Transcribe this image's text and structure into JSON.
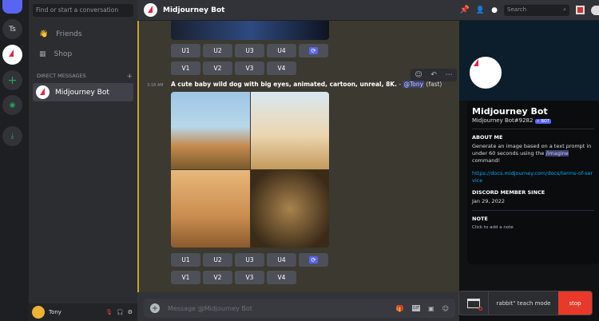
{
  "dm_sidebar": {
    "search_placeholder": "Find or start a conversation",
    "friends": "Friends",
    "shop": "Shop",
    "direct_messages": "DIRECT MESSAGES",
    "add": "+",
    "dm_item": "Midjourney Bot"
  },
  "servers": {
    "ts": "Ts"
  },
  "user": {
    "name": "Tony"
  },
  "header": {
    "title": "Midjourney Bot",
    "search_placeholder": "Search"
  },
  "message": {
    "time": "3:18 AM",
    "prompt": "A cute baby wild dog with big eyes, animated, cartoon, unreal, 8K.",
    "separator": " - ",
    "mention": "@Tony",
    "speed": "(fast)"
  },
  "buttons": {
    "u": [
      "U1",
      "U2",
      "U3",
      "U4"
    ],
    "v": [
      "V1",
      "V2",
      "V3",
      "V4"
    ],
    "refresh": "⟳"
  },
  "composer": {
    "placeholder": "Message @Midjourney Bot",
    "gif": "GIF"
  },
  "profile": {
    "name": "Midjourney Bot",
    "tag": "Midjourney Bot#9282",
    "badge": "✓ BOT",
    "about_title": "ABOUT ME",
    "about_pre": "Generate an image based on a text prompt in under 60 seconds using the ",
    "about_cmd": "/imagine",
    "about_post": " command!",
    "link": "https://docs.midjourney.com/docs/terms-of-service",
    "member_title": "DISCORD MEMBER SINCE",
    "member_date": "Jan 29, 2022",
    "note_title": "NOTE",
    "note_placeholder": "Click to add a note"
  },
  "teach": {
    "label": "rabbit\" teach mode",
    "stop": "stop"
  }
}
